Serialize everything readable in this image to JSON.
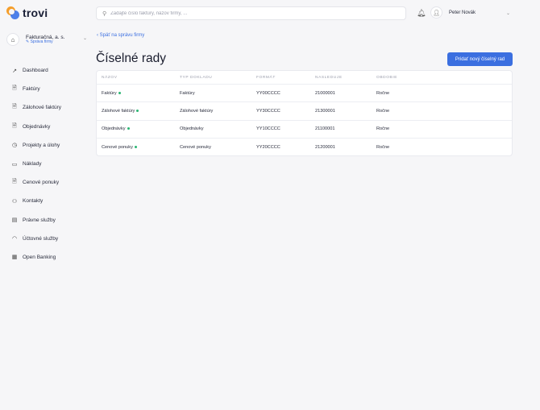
{
  "brand": {
    "name": "trovi"
  },
  "company": {
    "name": "Fakturačná, a. s.",
    "sub": "Správa firmy"
  },
  "sidebar": {
    "items": [
      {
        "label": "Dashboard",
        "icon": "trend-icon",
        "glyph": "↗"
      },
      {
        "label": "Faktúry",
        "icon": "document-icon",
        "glyph": "🗎"
      },
      {
        "label": "Zálohové faktúry",
        "icon": "document-icon",
        "glyph": "🗎"
      },
      {
        "label": "Objednávky",
        "icon": "document-icon",
        "glyph": "🗎"
      },
      {
        "label": "Projekty a úlohy",
        "icon": "clock-icon",
        "glyph": "◷"
      },
      {
        "label": "Náklady",
        "icon": "wallet-icon",
        "glyph": "▭"
      },
      {
        "label": "Cenové ponuky",
        "icon": "document-icon",
        "glyph": "🗎"
      },
      {
        "label": "Kontakty",
        "icon": "contacts-icon",
        "glyph": "⚇"
      },
      {
        "label": "Právne služby",
        "icon": "legal-icon",
        "glyph": "▤"
      },
      {
        "label": "Účtovné služby",
        "icon": "accounting-icon",
        "glyph": "◠"
      },
      {
        "label": "Open Banking",
        "icon": "bank-icon",
        "glyph": "▦"
      }
    ]
  },
  "search": {
    "placeholder": "Zadajte číslo faktúry, názov firmy, ..."
  },
  "user": {
    "name": "Peter Novák"
  },
  "main": {
    "back_label": "Späť na správu firmy",
    "title": "Číselné rady",
    "add_button": "Pridať nový číselný rad",
    "table": {
      "headers": [
        "NÁZOV",
        "TYP DOKLADU",
        "FORMÁT",
        "NASLEDUJE",
        "OBDOBIE"
      ],
      "rows": [
        [
          "Faktúry",
          "Faktúry",
          "YY00CCCC",
          "21000001",
          "Ročne"
        ],
        [
          "Zálohové faktúry",
          "Zálohové faktúry",
          "YY30CCCC",
          "21300001",
          "Ročne"
        ],
        [
          "Objednávky",
          "Objednávky",
          "YY10CCCC",
          "21100001",
          "Ročne"
        ],
        [
          "Cenové ponuky",
          "Cenové ponuky",
          "YY20CCCC",
          "21200001",
          "Ročne"
        ]
      ]
    }
  },
  "colors": {
    "accent": "#3b6fe0",
    "status_dot": "#2bb673",
    "background": "#f6f6f8"
  }
}
